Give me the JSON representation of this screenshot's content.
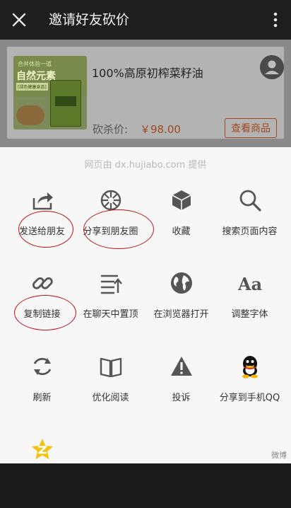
{
  "topbar": {
    "title": "邀请好友砍价",
    "close_icon": "close-icon",
    "more_icon": "more-vertical-icon"
  },
  "product": {
    "thumb_text1": "合并体验一道",
    "thumb_text2": "自然元素",
    "thumb_text3": "[绿色健康食品]",
    "title": "100%高原初榨菜籽油",
    "price_label": "砍杀价:",
    "price": "￥98.00",
    "view_button": "查看商品"
  },
  "sheet": {
    "provider": "网页由 dx.hujiabo.com 提供",
    "items": [
      {
        "label": "发送给朋友",
        "icon": "share-icon"
      },
      {
        "label": "分享到朋友圈",
        "icon": "moments-icon"
      },
      {
        "label": "收藏",
        "icon": "cube-icon"
      },
      {
        "label": "搜索页面内容",
        "icon": "search-icon"
      },
      {
        "label": "复制链接",
        "icon": "link-icon"
      },
      {
        "label": "在聊天中置顶",
        "icon": "pin-top-icon"
      },
      {
        "label": "在浏览器打开",
        "icon": "globe-icon"
      },
      {
        "label": "调整字体",
        "icon": "font-icon"
      },
      {
        "label": "刷新",
        "icon": "refresh-icon"
      },
      {
        "label": "优化阅读",
        "icon": "book-icon"
      },
      {
        "label": "投诉",
        "icon": "warning-icon"
      },
      {
        "label": "分享到手机QQ",
        "icon": "qq-icon"
      },
      {
        "label": "",
        "icon": "qzone-icon"
      }
    ]
  },
  "watermark": "微博"
}
